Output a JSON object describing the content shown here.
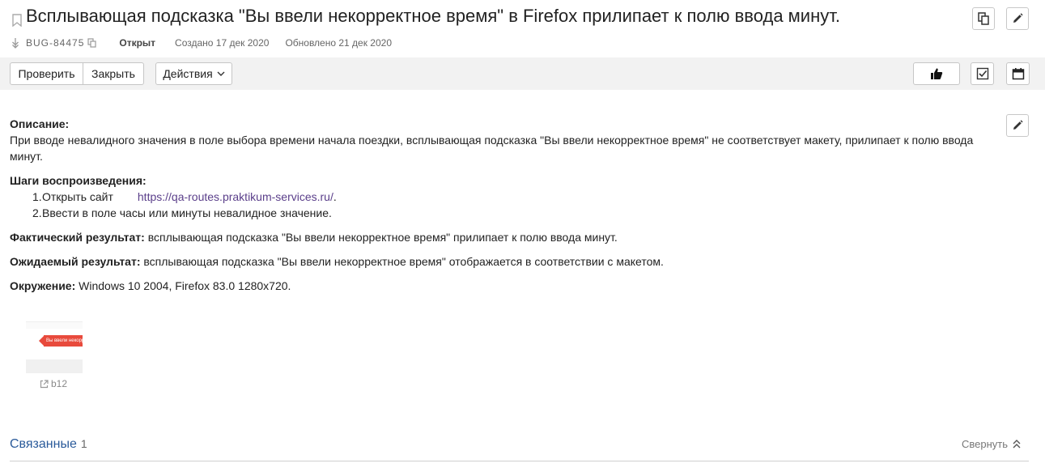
{
  "issue": {
    "title": "Всплывающая подсказка \"Вы ввели некорректное время\" в Firefox прилипает к полю ввода минут.",
    "id": "BUG-84475",
    "status": "Открыт",
    "created": "Создано 17 дек 2020",
    "updated": "Обновлено 21 дек 2020"
  },
  "toolbar": {
    "check_label": "Проверить",
    "close_label": "Закрыть",
    "actions_label": "Действия"
  },
  "description": {
    "desc_heading": "Описание:",
    "desc_text": "При вводе невалидного значения в поле выбора времени начала поездки, всплывающая подсказка \"Вы ввели некорректное время\" не соответствует макету, прилипает к полю ввода минут.",
    "steps_heading": "Шаги воспроизведения:",
    "steps": [
      {
        "num": "1.",
        "text": "Открыть сайт",
        "link": "https://qa-routes.praktikum-services.ru/",
        "after": "."
      },
      {
        "num": "2.",
        "text": "Ввести в поле часы или минуты невалидное значение."
      }
    ],
    "actual_label": "Фактический результат:",
    "actual_text": "всплывающая подсказка \"Вы ввели некорректное время\" прилипает к полю ввода минут.",
    "expected_label": "Ожидаемый результат:",
    "expected_text": "всплывающая подсказка \"Вы ввели некорректное время\" отображается в соответствии с макетом.",
    "env_label": "Окружение:",
    "env_text": "Windows 10 2004, Firefox 83.0 1280x720."
  },
  "attachment": {
    "name": "b12",
    "preview_text": "Вы ввели некорр"
  },
  "related": {
    "label": "Связанные",
    "count": "1",
    "collapse_label": "Свернуть"
  },
  "colors": {
    "link": "#5a3e8a",
    "related": "#2a5a9a",
    "tooltip_red": "#e84a3c"
  }
}
